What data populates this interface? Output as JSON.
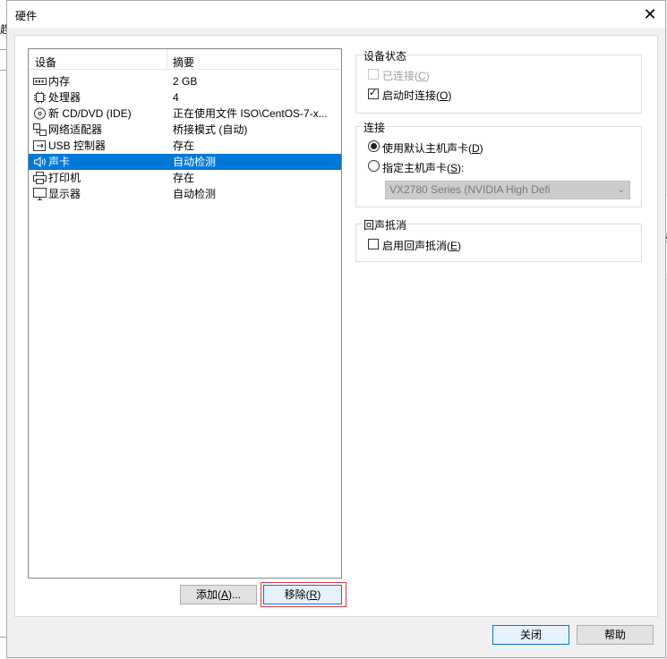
{
  "window": {
    "title": "硬件",
    "close_glyph": "✕"
  },
  "background": {
    "left_fragment": "趕",
    "right_fragment": "器"
  },
  "device_list": {
    "columns": [
      "设备",
      "摘要"
    ],
    "rows": [
      {
        "icon": "memory-icon",
        "name": "内存",
        "summary": "2 GB",
        "selected": false
      },
      {
        "icon": "processor-icon",
        "name": "处理器",
        "summary": "4",
        "selected": false
      },
      {
        "icon": "cd-dvd-icon",
        "name": "新 CD/DVD (IDE)",
        "summary": "正在使用文件 ISO\\CentOS-7-x...",
        "selected": false
      },
      {
        "icon": "network-adapter-icon",
        "name": "网络适配器",
        "summary": "桥接模式 (自动)",
        "selected": false
      },
      {
        "icon": "usb-controller-icon",
        "name": "USB 控制器",
        "summary": "存在",
        "selected": false
      },
      {
        "icon": "sound-card-icon",
        "name": "声卡",
        "summary": "自动检测",
        "selected": true
      },
      {
        "icon": "printer-icon",
        "name": "打印机",
        "summary": "存在",
        "selected": false
      },
      {
        "icon": "display-icon",
        "name": "显示器",
        "summary": "自动检测",
        "selected": false
      }
    ]
  },
  "buttons": {
    "add": {
      "pre": "添加(",
      "key": "A",
      "post": ")..."
    },
    "remove": {
      "pre": "移除(",
      "key": "R",
      "post": ")"
    },
    "close": "关闭",
    "help": "帮助"
  },
  "device_status": {
    "title": "设备状态",
    "connected": {
      "pre": "已连接(",
      "key": "C",
      "post": ")",
      "checked": false,
      "enabled": false
    },
    "connect_at_power_on": {
      "pre": "启动时连接(",
      "key": "O",
      "post": ")",
      "checked": true,
      "enabled": true
    }
  },
  "connection": {
    "title": "连接",
    "use_default": {
      "pre": "使用默认主机声卡(",
      "key": "D",
      "post": ")",
      "selected": true
    },
    "specify": {
      "pre": "指定主机声卡(",
      "key": "S",
      "post": "):",
      "selected": false
    },
    "host_card_value": "VX2780 Series (NVIDIA High Defi"
  },
  "echo_cancel": {
    "title": "回声抵消",
    "enable": {
      "pre": "启用回声抵消(",
      "key": "E",
      "post": ")",
      "checked": false
    }
  },
  "colors": {
    "selection": "#0078d7",
    "focus_border": "#0078d7",
    "highlight_box": "#e0383e"
  }
}
